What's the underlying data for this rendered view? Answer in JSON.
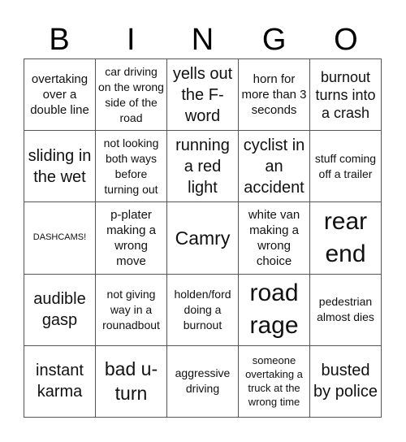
{
  "title": {
    "letters": [
      "B",
      "I",
      "N",
      "G",
      "O"
    ]
  },
  "card": {
    "rows": [
      [
        {
          "text": "overtaking over a double line",
          "size": "md"
        },
        {
          "text": "car driving on the wrong side of the road",
          "size": "sm"
        },
        {
          "text": "yells out the F-word",
          "size": "lg"
        },
        {
          "text": "horn for more than 3 seconds",
          "size": "md"
        },
        {
          "text": "burnout turns into a crash",
          "size": "lg-sm"
        }
      ],
      [
        {
          "text": "sliding in the wet",
          "size": "lg"
        },
        {
          "text": "not looking both ways before turning out",
          "size": "sm"
        },
        {
          "text": "running a red light",
          "size": "lg"
        },
        {
          "text": "cyclist in an accident",
          "size": "lg"
        },
        {
          "text": "stuff coming off a trailer",
          "size": "sm"
        }
      ],
      [
        {
          "text": "DASHCAMS!",
          "size": "xs"
        },
        {
          "text": "p-plater making a wrong move",
          "size": "md"
        },
        {
          "text": "Camry",
          "size": "xl"
        },
        {
          "text": "white van making a wrong choice",
          "size": "md"
        },
        {
          "text": "rear end",
          "size": "xxl"
        }
      ],
      [
        {
          "text": "audible gasp",
          "size": "lg"
        },
        {
          "text": "not giving way in a rounadbout",
          "size": "sm"
        },
        {
          "text": "holden/ford doing a burnout",
          "size": "sm"
        },
        {
          "text": "road rage",
          "size": "xxl"
        },
        {
          "text": "pedestrian almost dies",
          "size": "sm"
        }
      ],
      [
        {
          "text": "instant karma",
          "size": "lg"
        },
        {
          "text": "bad u-turn",
          "size": "xl"
        },
        {
          "text": "aggressive driving",
          "size": "sm"
        },
        {
          "text": "someone overtaking a truck at the wrong time",
          "size": "xs"
        },
        {
          "text": "busted by police",
          "size": "lg"
        }
      ]
    ]
  }
}
